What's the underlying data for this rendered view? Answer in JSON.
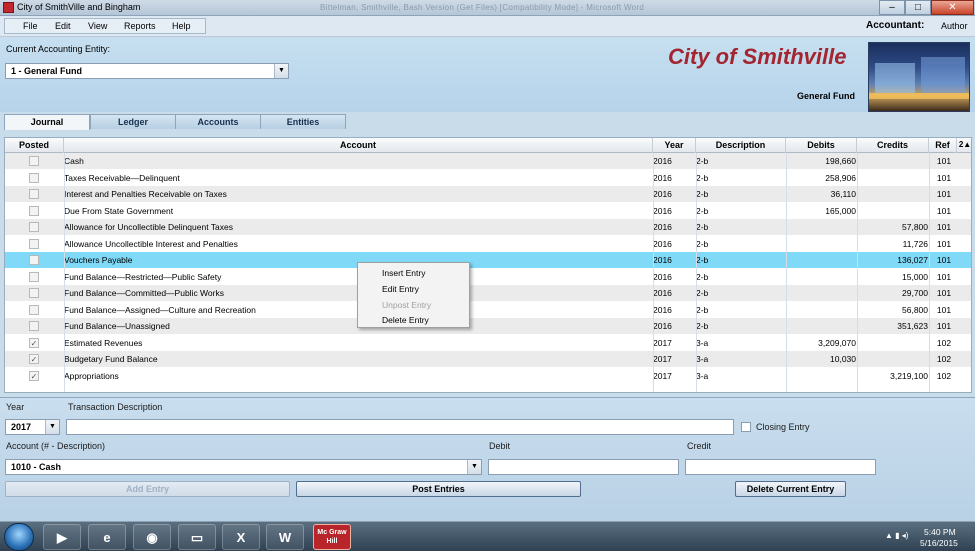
{
  "window": {
    "title": "City of SmithVille and Bingham",
    "ghost_title": "Bittelman, Smithville, Bash Version (Get Files) [Compatibility Mode] - Microsoft Word"
  },
  "menu": [
    "File",
    "Edit",
    "View",
    "Reports",
    "Help"
  ],
  "accountant": {
    "label": "Accountant:",
    "name": "Author"
  },
  "header": {
    "entity_label": "Current Accounting Entity:",
    "entity_value": "1 - General Fund",
    "city": "City of Smithville",
    "fund": "General Fund"
  },
  "tabs": [
    "Journal",
    "Ledger",
    "Accounts",
    "Entities"
  ],
  "grid": {
    "columns": [
      "Posted",
      "Account",
      "Year",
      "Description",
      "Debits",
      "Credits",
      "Ref",
      "2"
    ],
    "sort_indicator": "▲",
    "rows": [
      {
        "posted": false,
        "account": "Cash",
        "year": "2016",
        "desc": "2-b",
        "debit": "198,660",
        "credit": "",
        "ref": "101"
      },
      {
        "posted": false,
        "account": "Taxes Receivable—Delinquent",
        "year": "2016",
        "desc": "2-b",
        "debit": "258,906",
        "credit": "",
        "ref": "101"
      },
      {
        "posted": false,
        "account": "Interest and Penalties Receivable on Taxes",
        "year": "2016",
        "desc": "2-b",
        "debit": "36,110",
        "credit": "",
        "ref": "101"
      },
      {
        "posted": false,
        "account": "Due From State Government",
        "year": "2016",
        "desc": "2-b",
        "debit": "165,000",
        "credit": "",
        "ref": "101"
      },
      {
        "posted": false,
        "account": "Allowance for Uncollectible Delinquent Taxes",
        "year": "2016",
        "desc": "2-b",
        "debit": "",
        "credit": "57,800",
        "ref": "101"
      },
      {
        "posted": false,
        "account": "Allowance Uncollectible Interest and Penalties",
        "year": "2016",
        "desc": "2-b",
        "debit": "",
        "credit": "11,726",
        "ref": "101"
      },
      {
        "posted": false,
        "account": "Vouchers Payable",
        "year": "2016",
        "desc": "2-b",
        "debit": "",
        "credit": "136,027",
        "ref": "101"
      },
      {
        "posted": false,
        "account": "Fund Balance—Restricted—Public Safety",
        "year": "2016",
        "desc": "2-b",
        "debit": "",
        "credit": "15,000",
        "ref": "101"
      },
      {
        "posted": false,
        "account": "Fund Balance—Committed—Public Works",
        "year": "2016",
        "desc": "2-b",
        "debit": "",
        "credit": "29,700",
        "ref": "101"
      },
      {
        "posted": false,
        "account": "Fund Balance—Assigned—Culture and Recreation",
        "year": "2016",
        "desc": "2-b",
        "debit": "",
        "credit": "56,800",
        "ref": "101"
      },
      {
        "posted": false,
        "account": "Fund Balance—Unassigned",
        "year": "2016",
        "desc": "2-b",
        "debit": "",
        "credit": "351,623",
        "ref": "101"
      },
      {
        "posted": true,
        "account": "Estimated Revenues",
        "year": "2017",
        "desc": "3-a",
        "debit": "3,209,070",
        "credit": "",
        "ref": "102"
      },
      {
        "posted": true,
        "account": "Budgetary Fund Balance",
        "year": "2017",
        "desc": "3-a",
        "debit": "10,030",
        "credit": "",
        "ref": "102"
      },
      {
        "posted": true,
        "account": "Appropriations",
        "year": "2017",
        "desc": "3-a",
        "debit": "",
        "credit": "3,219,100",
        "ref": "102"
      }
    ]
  },
  "context_menu": [
    {
      "label": "Insert Entry",
      "enabled": true
    },
    {
      "label": "Edit Entry",
      "enabled": true
    },
    {
      "label": "Unpost Entry",
      "enabled": false
    },
    {
      "label": "Delete Entry",
      "enabled": true
    }
  ],
  "form": {
    "year_label": "Year",
    "year_value": "2017",
    "trans_desc_label": "Transaction Description",
    "trans_desc_value": "",
    "closing_entry_label": "Closing Entry",
    "account_label": "Account (# - Description)",
    "account_value": "1010 - Cash",
    "debit_label": "Debit",
    "credit_label": "Credit",
    "add_entry": "Add Entry",
    "post_entries": "Post Entries",
    "delete_current": "Delete Current Entry"
  },
  "taskbar": {
    "time": "5:40 PM",
    "date": "5/16/2015",
    "items": [
      "media-player",
      "internet-explorer",
      "chrome",
      "file-explorer",
      "excel",
      "word",
      "mcgraw-hill"
    ],
    "mcgraw_label": "Mc Graw Hill"
  }
}
